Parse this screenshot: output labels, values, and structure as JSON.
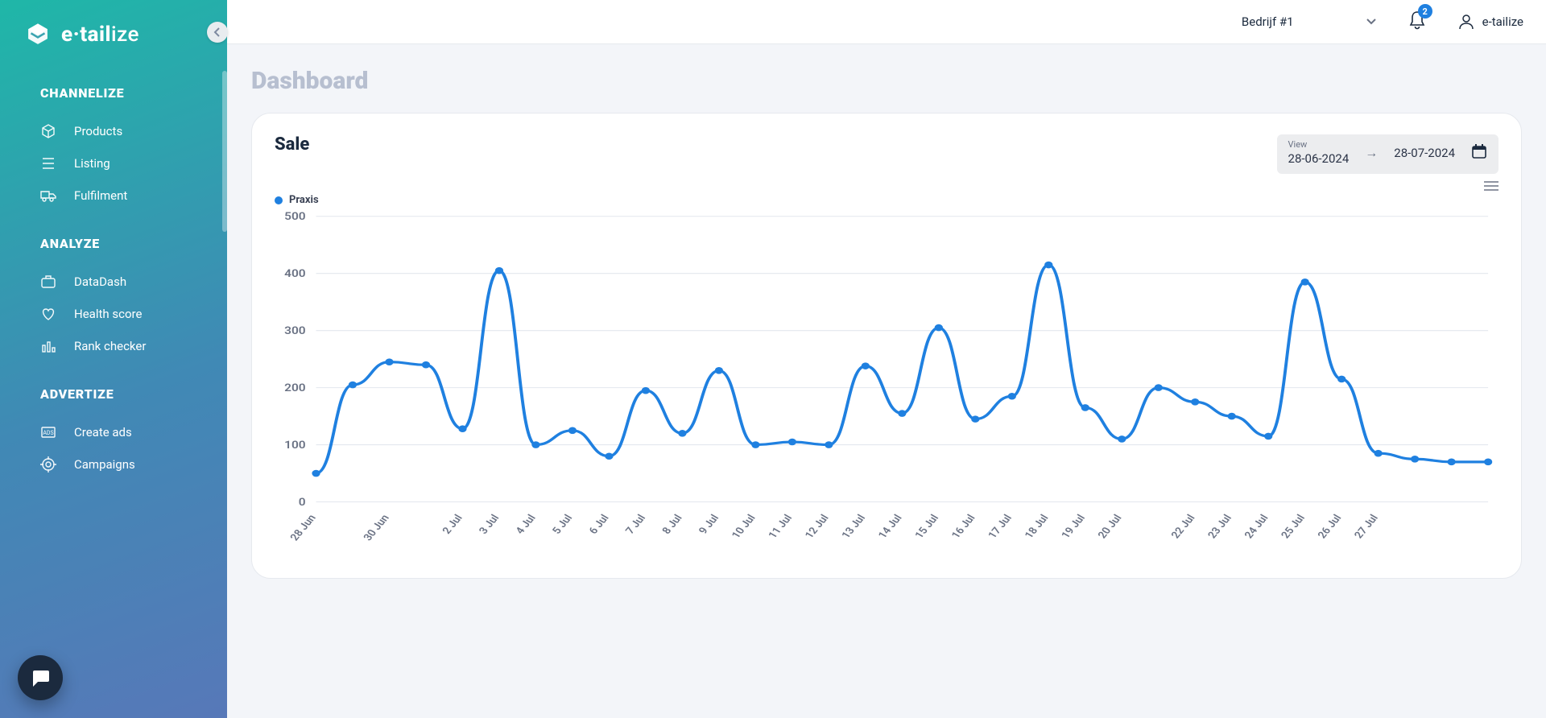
{
  "brand": {
    "name_html_prefix": "e·tail",
    "name_html_suffix": "ize"
  },
  "topbar": {
    "company": "Bedrijf #1",
    "notifications": 2,
    "username": "e-tailize"
  },
  "sidebar": {
    "sections": [
      {
        "title": "CHANNELIZE",
        "items": [
          {
            "label": "Products",
            "icon": "package-icon"
          },
          {
            "label": "Listing",
            "icon": "list-icon"
          },
          {
            "label": "Fulfilment",
            "icon": "truck-icon"
          }
        ]
      },
      {
        "title": "ANALYZE",
        "items": [
          {
            "label": "DataDash",
            "icon": "briefcase-icon"
          },
          {
            "label": "Health score",
            "icon": "heart-icon"
          },
          {
            "label": "Rank checker",
            "icon": "bar-icon"
          }
        ]
      },
      {
        "title": "ADVERTIZE",
        "items": [
          {
            "label": "Create ads",
            "icon": "ad-icon"
          },
          {
            "label": "Campaigns",
            "icon": "target-icon"
          }
        ]
      }
    ]
  },
  "page": {
    "title": "Dashboard"
  },
  "card": {
    "title": "Sale",
    "date_range": {
      "label": "View",
      "from": "28-06-2024",
      "to": "28-07-2024"
    }
  },
  "chart_data": {
    "type": "line",
    "title": "Sale",
    "xlabel": "",
    "ylabel": "",
    "ylim": [
      0,
      500
    ],
    "yticks": [
      0,
      100,
      200,
      300,
      400,
      500
    ],
    "legend": [
      "Praxis"
    ],
    "categories": [
      "28 Jun",
      "",
      "30 Jun",
      "",
      "2 Jul",
      "3 Jul",
      "4 Jul",
      "5 Jul",
      "6 Jul",
      "7 Jul",
      "8 Jul",
      "9 Jul",
      "10 Jul",
      "11 Jul",
      "12 Jul",
      "13 Jul",
      "14 Jul",
      "15 Jul",
      "16 Jul",
      "17 Jul",
      "18 Jul",
      "19 Jul",
      "20 Jul",
      "",
      "22 Jul",
      "23 Jul",
      "24 Jul",
      "25 Jul",
      "26 Jul",
      "27 Jul",
      ""
    ],
    "series": [
      {
        "name": "Praxis",
        "values": [
          50,
          205,
          245,
          240,
          128,
          405,
          100,
          125,
          80,
          195,
          120,
          230,
          100,
          105,
          100,
          238,
          155,
          305,
          145,
          185,
          415,
          165,
          110,
          200,
          175,
          150,
          115,
          385,
          215,
          85,
          75,
          70,
          70
        ]
      }
    ]
  }
}
